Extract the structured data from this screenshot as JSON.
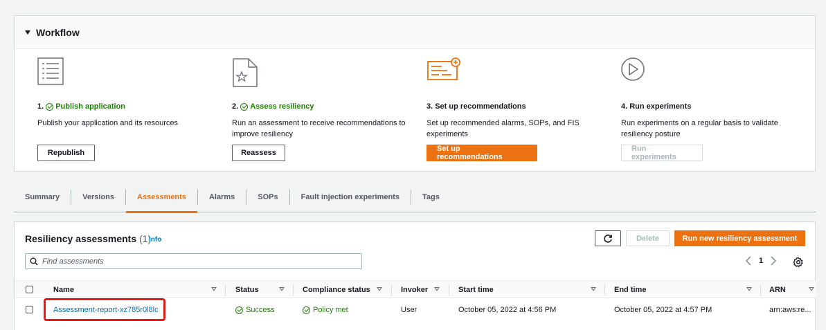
{
  "workflow": {
    "title": "Workflow",
    "steps": [
      {
        "num": "1.",
        "title": "Publish application",
        "desc": "Publish your application and its resources",
        "button": "Republish",
        "icon": "list-document-icon"
      },
      {
        "num": "2.",
        "title": "Assess resiliency",
        "desc": "Run an assessment to receive recommendations to improve resiliency",
        "button": "Reassess",
        "icon": "star-document-icon"
      },
      {
        "num": "3.",
        "title": "Set up recommendations",
        "desc": "Set up recommended alarms, SOPs, and FIS experiments",
        "button": "Set up recommendations",
        "icon": "recommendations-icon"
      },
      {
        "num": "4.",
        "title": "Run experiments",
        "desc": "Run experiments on a regular basis to validate resiliency posture",
        "button": "Run experiments",
        "icon": "play-circle-icon"
      }
    ]
  },
  "tabs": [
    "Summary",
    "Versions",
    "Assessments",
    "Alarms",
    "SOPs",
    "Fault injection experiments",
    "Tags"
  ],
  "active_tab": "Assessments",
  "assessments": {
    "title": "Resiliency assessments",
    "count": "(1)",
    "info": "Info",
    "delete_label": "Delete",
    "run_label": "Run new resiliency assessment",
    "search_placeholder": "Find assessments",
    "page": "1",
    "columns": [
      "Name",
      "Status",
      "Compliance status",
      "Invoker",
      "Start time",
      "End time",
      "ARN"
    ],
    "rows": [
      {
        "name": "Assessment-report-xz785r0l8lc",
        "status": "Success",
        "compliance": "Policy met",
        "invoker": "User",
        "start": "October 05, 2022 at 4:56 PM",
        "end": "October 05, 2022 at 4:57 PM",
        "arn": "arn:aws:re..."
      }
    ]
  },
  "colors": {
    "accent": "#ec7211",
    "link": "#0073bb",
    "success": "#1d8102",
    "highlight": "#e31b14"
  }
}
